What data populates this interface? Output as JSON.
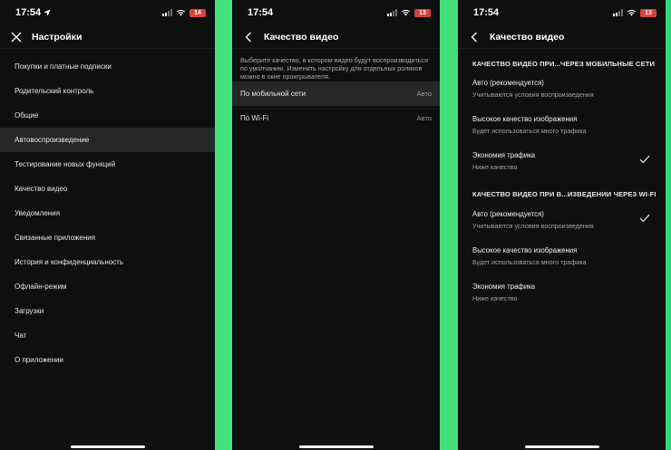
{
  "colors": {
    "background": "#0f0f0f",
    "highlight": "#272727",
    "accent_green": "#3ee07b",
    "battery": "#d8413a"
  },
  "screen1": {
    "status": {
      "time": "17:54",
      "battery": "14"
    },
    "header": {
      "title": "Настройки",
      "icon": "close-icon"
    },
    "items": [
      {
        "label": "Покупки и платные подписки"
      },
      {
        "label": "Родительский контроль"
      },
      {
        "label": "Общие"
      },
      {
        "label": "Автовоспроизведение",
        "active": true
      },
      {
        "label": "Тестирование новых функций"
      },
      {
        "label": "Качество видео"
      },
      {
        "label": "Уведомления"
      },
      {
        "label": "Связанные приложения"
      },
      {
        "label": "История и конфиденциальность"
      },
      {
        "label": "Офлайн-режим"
      },
      {
        "label": "Загрузки"
      },
      {
        "label": "Чат"
      },
      {
        "label": "О приложении"
      }
    ]
  },
  "screen2": {
    "status": {
      "time": "17:54",
      "battery": "13"
    },
    "header": {
      "title": "Качество видео",
      "icon": "chevron-left-icon"
    },
    "description": "Выберите качество, в котором видео будут воспроизводиться по умолчанию. Изменить настройку для отдельных роликов можно в окне проигрывателя.",
    "rows": [
      {
        "label": "По мобильной сети",
        "value": "Авто"
      },
      {
        "label": "По Wi-Fi",
        "value": "Авто"
      }
    ]
  },
  "screen3": {
    "status": {
      "time": "17:54",
      "battery": "13"
    },
    "header": {
      "title": "Качество видео",
      "icon": "chevron-left-icon"
    },
    "mobile": {
      "title": "КАЧЕСТВО ВИДЕО ПРИ...ЧЕРЕЗ МОБИЛЬНЫЕ СЕТИ",
      "options": [
        {
          "title": "Авто (рекомендуется)",
          "subtitle": "Учитываются условия воспроизведения",
          "checked": false
        },
        {
          "title": "Высокое качество изображения",
          "subtitle": "Будет использоваться много трафика",
          "checked": false
        },
        {
          "title": "Экономия трафика",
          "subtitle": "Ниже качество",
          "checked": true
        }
      ]
    },
    "wifi": {
      "title": "КАЧЕСТВО ВИДЕО ПРИ В...ИЗВЕДЕНИИ ЧЕРЕЗ WI-FI",
      "options": [
        {
          "title": "Авто (рекомендуется)",
          "subtitle": "Учитываются условия воспроизведения",
          "checked": true
        },
        {
          "title": "Высокое качество изображения",
          "subtitle": "Будет использоваться много трафика",
          "checked": false
        },
        {
          "title": "Экономия трафика",
          "subtitle": "Ниже качество",
          "checked": false
        }
      ]
    }
  }
}
